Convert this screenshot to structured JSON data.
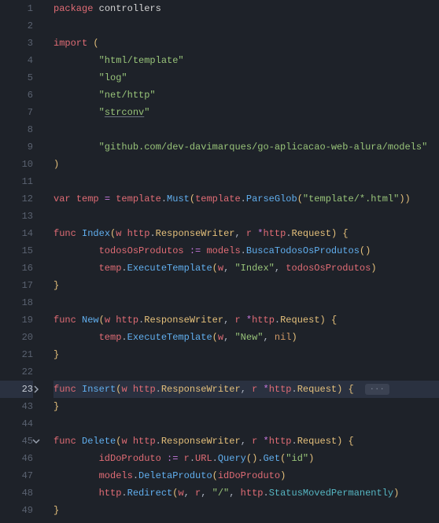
{
  "gutter": {
    "l1": "1",
    "l2": "2",
    "l3": "3",
    "l4": "4",
    "l5": "5",
    "l6": "6",
    "l7": "7",
    "l8": "8",
    "l9": "9",
    "l10": "10",
    "l11": "11",
    "l12": "12",
    "l13": "13",
    "l14": "14",
    "l15": "15",
    "l16": "16",
    "l17": "17",
    "l18": "18",
    "l19": "19",
    "l20": "20",
    "l21": "21",
    "l22": "22",
    "l23": "23",
    "l43": "43",
    "l44": "44",
    "l45": "45",
    "l46": "46",
    "l47": "47",
    "l48": "48",
    "l49": "49"
  },
  "tok": {
    "package": "package",
    "controllers": "controllers",
    "import": "import",
    "lparen": "(",
    "rparen": ")",
    "s_html_template": "\"html/template\"",
    "s_log": "\"log\"",
    "s_net_http": "\"net/http\"",
    "s_strconv_open": "\"",
    "s_strconv_mid": "strconv",
    "s_strconv_close": "\"",
    "s_github": "\"github.com/dev-davimarques/go-aplicacao-web-alura/models\"",
    "var": "var",
    "temp": "temp",
    "eq": "=",
    "template": "template",
    "dot": ".",
    "Must": "Must",
    "ParseGlob": "ParseGlob",
    "s_tmplglob": "\"template/*.html\"",
    "func": "func",
    "Index": "Index",
    "w": "w",
    "http": "http",
    "ResponseWriter": "ResponseWriter",
    "comma": ", ",
    "r": "r",
    "star": "*",
    "Request": "Request",
    "lbrace": "{",
    "rbrace": "}",
    "todosOsProdutos": "todosOsProdutos",
    "coloneq": ":=",
    "models": "models",
    "BuscaTodosOsProdutos": "BuscaTodosOsProdutos",
    "ExecuteTemplate": "ExecuteTemplate",
    "s_Index": "\"Index\"",
    "New": "New",
    "s_New": "\"New\"",
    "nil": "nil",
    "Insert": "Insert",
    "fold": "···",
    "Delete": "Delete",
    "idDoProduto": "idDoProduto",
    "URL": "URL",
    "Query": "Query",
    "Get": "Get",
    "s_id": "\"id\"",
    "DeletaProduto": "DeletaProduto",
    "Redirect": "Redirect",
    "s_slash": "\"/\"",
    "StatusMovedPermanently": "StatusMovedPermanently",
    "sp": " "
  }
}
